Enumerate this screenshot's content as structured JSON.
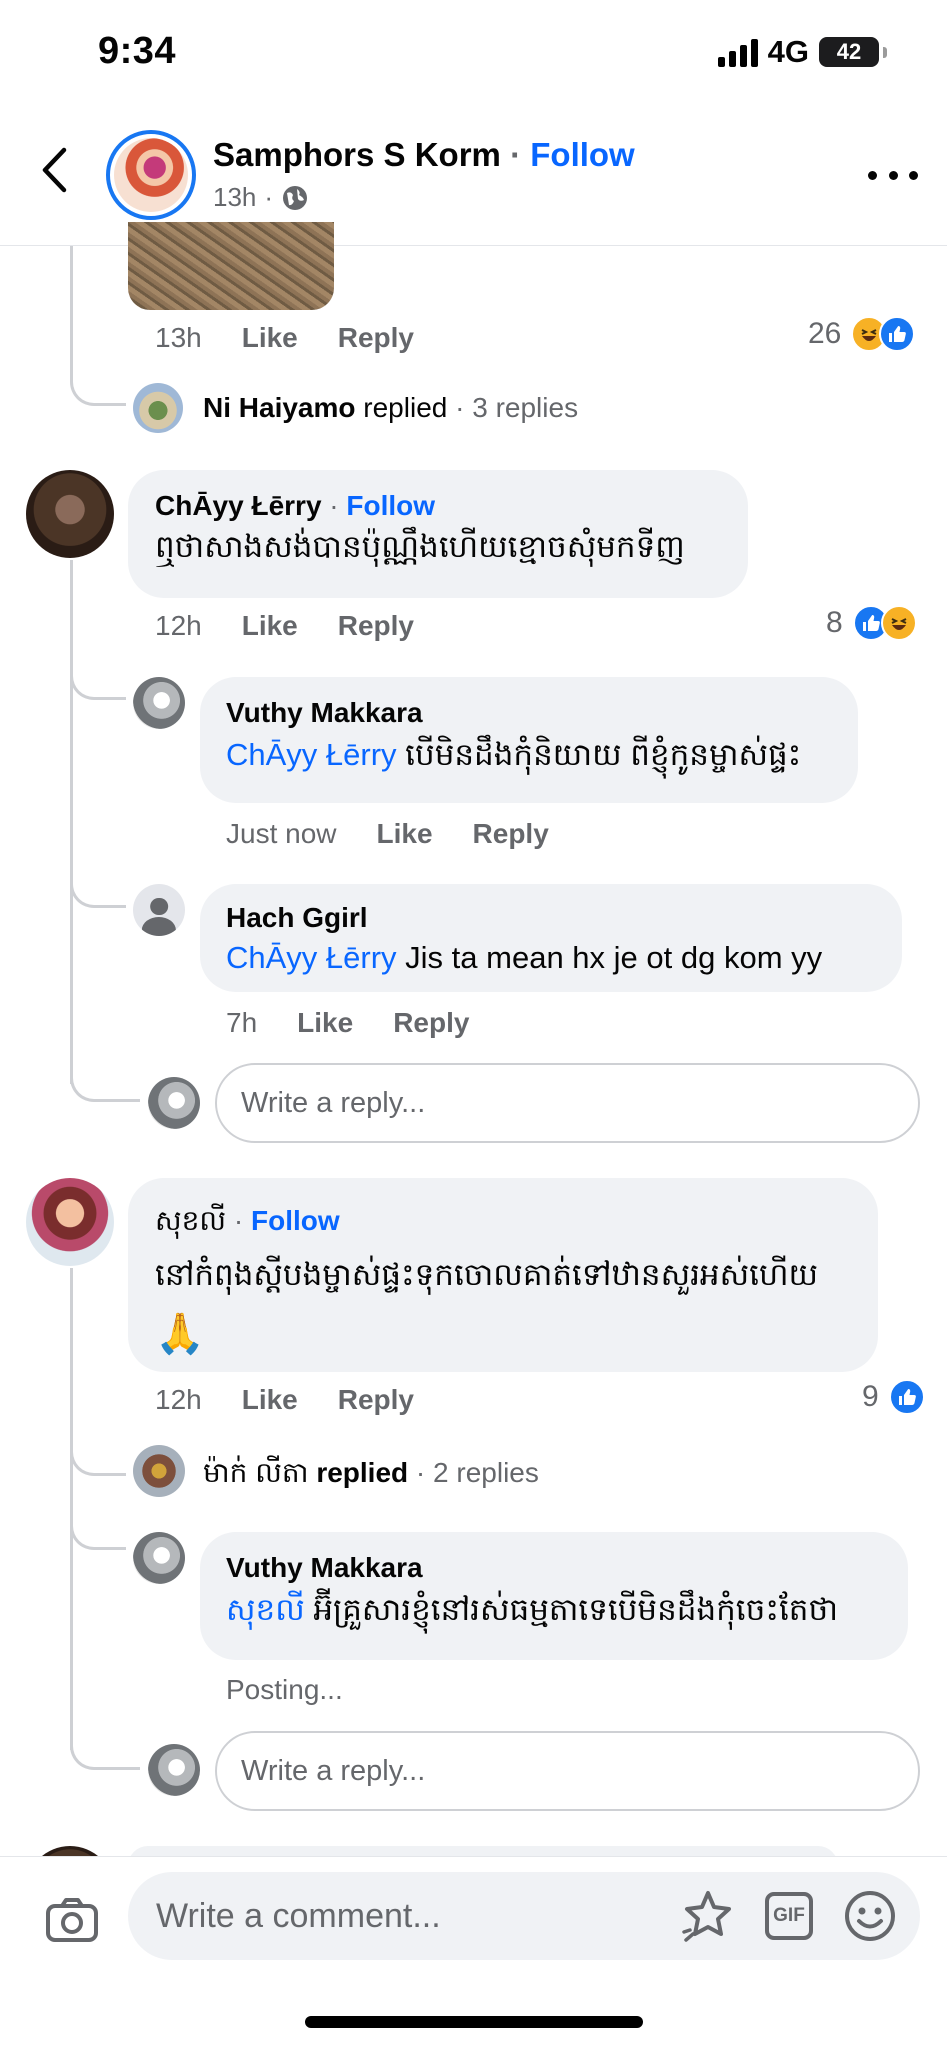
{
  "status_bar": {
    "time": "9:34",
    "network": "4G",
    "battery": "42"
  },
  "header": {
    "name": "Samphors S Korm",
    "separator": "·",
    "follow_label": "Follow",
    "time": "13h",
    "time_sep": "·"
  },
  "top_comment": {
    "time": "13h",
    "like": "Like",
    "reply": "Reply",
    "reaction_count": "26"
  },
  "thread_summary_1": {
    "name": "Ni Haiyamo",
    "replied": "replied",
    "replies": "· 3 replies"
  },
  "comment_chayy": {
    "author": "ChĀyy Łērry",
    "separator": "·",
    "follow_label": "Follow",
    "text": "ឮថាសាងសង់បានប៉ុណ្ណឹងហើយខ្មោចសុំមកទីញ",
    "time": "12h",
    "like": "Like",
    "reply": "Reply",
    "reaction_count": "8"
  },
  "reply_vuthy_1": {
    "author": "Vuthy Makkara",
    "mention": "ChĀyy Łērry",
    "text": "បើមិនដឹងកុំនិយាយ ពីខ្ញុំកូនម្ចាស់ផ្ទះ",
    "time": "Just now",
    "like": "Like",
    "reply": "Reply"
  },
  "reply_hach": {
    "author": "Hach Ggirl",
    "mention": "ChĀyy Łērry",
    "text": "Jis ta mean hx je ot dg kom yy",
    "time": "7h",
    "like": "Like",
    "reply": "Reply"
  },
  "reply_box_1": {
    "placeholder": "Write a reply..."
  },
  "comment_sok": {
    "author": "សុខលី",
    "separator": "·",
    "follow_label": "Follow",
    "text": "នៅកំពុងស្ដីបងម្ចាស់ផ្ទះទុកចោលគាត់ទៅឋានសួរអស់ហើយ",
    "emoji": "🙏",
    "time": "12h",
    "like": "Like",
    "reply": "Reply",
    "reaction_count": "9"
  },
  "thread_summary_2": {
    "name": "ម៉ាក់ លីតា",
    "replied": "replied",
    "replies": "· 2 replies"
  },
  "reply_vuthy_2": {
    "author": "Vuthy Makkara",
    "mention": "សុខលី",
    "text": "អ៊ីគ្រួសារខ្ញុំនៅរស់ធម្មតាទេបើមិនដឹងកុំចេះតែថា",
    "status": "Posting..."
  },
  "reply_box_2": {
    "placeholder": "Write a reply..."
  },
  "composer": {
    "placeholder": "Write a comment...",
    "gif_label": "GIF"
  },
  "colors": {
    "accent": "#0866ff",
    "bubble": "#f0f2f5",
    "muted": "#65676b",
    "line": "#ced0d4"
  },
  "icons": [
    "back-icon",
    "globe-icon",
    "more-icon",
    "like-reaction-icon",
    "haha-reaction-icon",
    "camera-icon",
    "sticker-icon",
    "gif-icon",
    "emoji-icon"
  ]
}
